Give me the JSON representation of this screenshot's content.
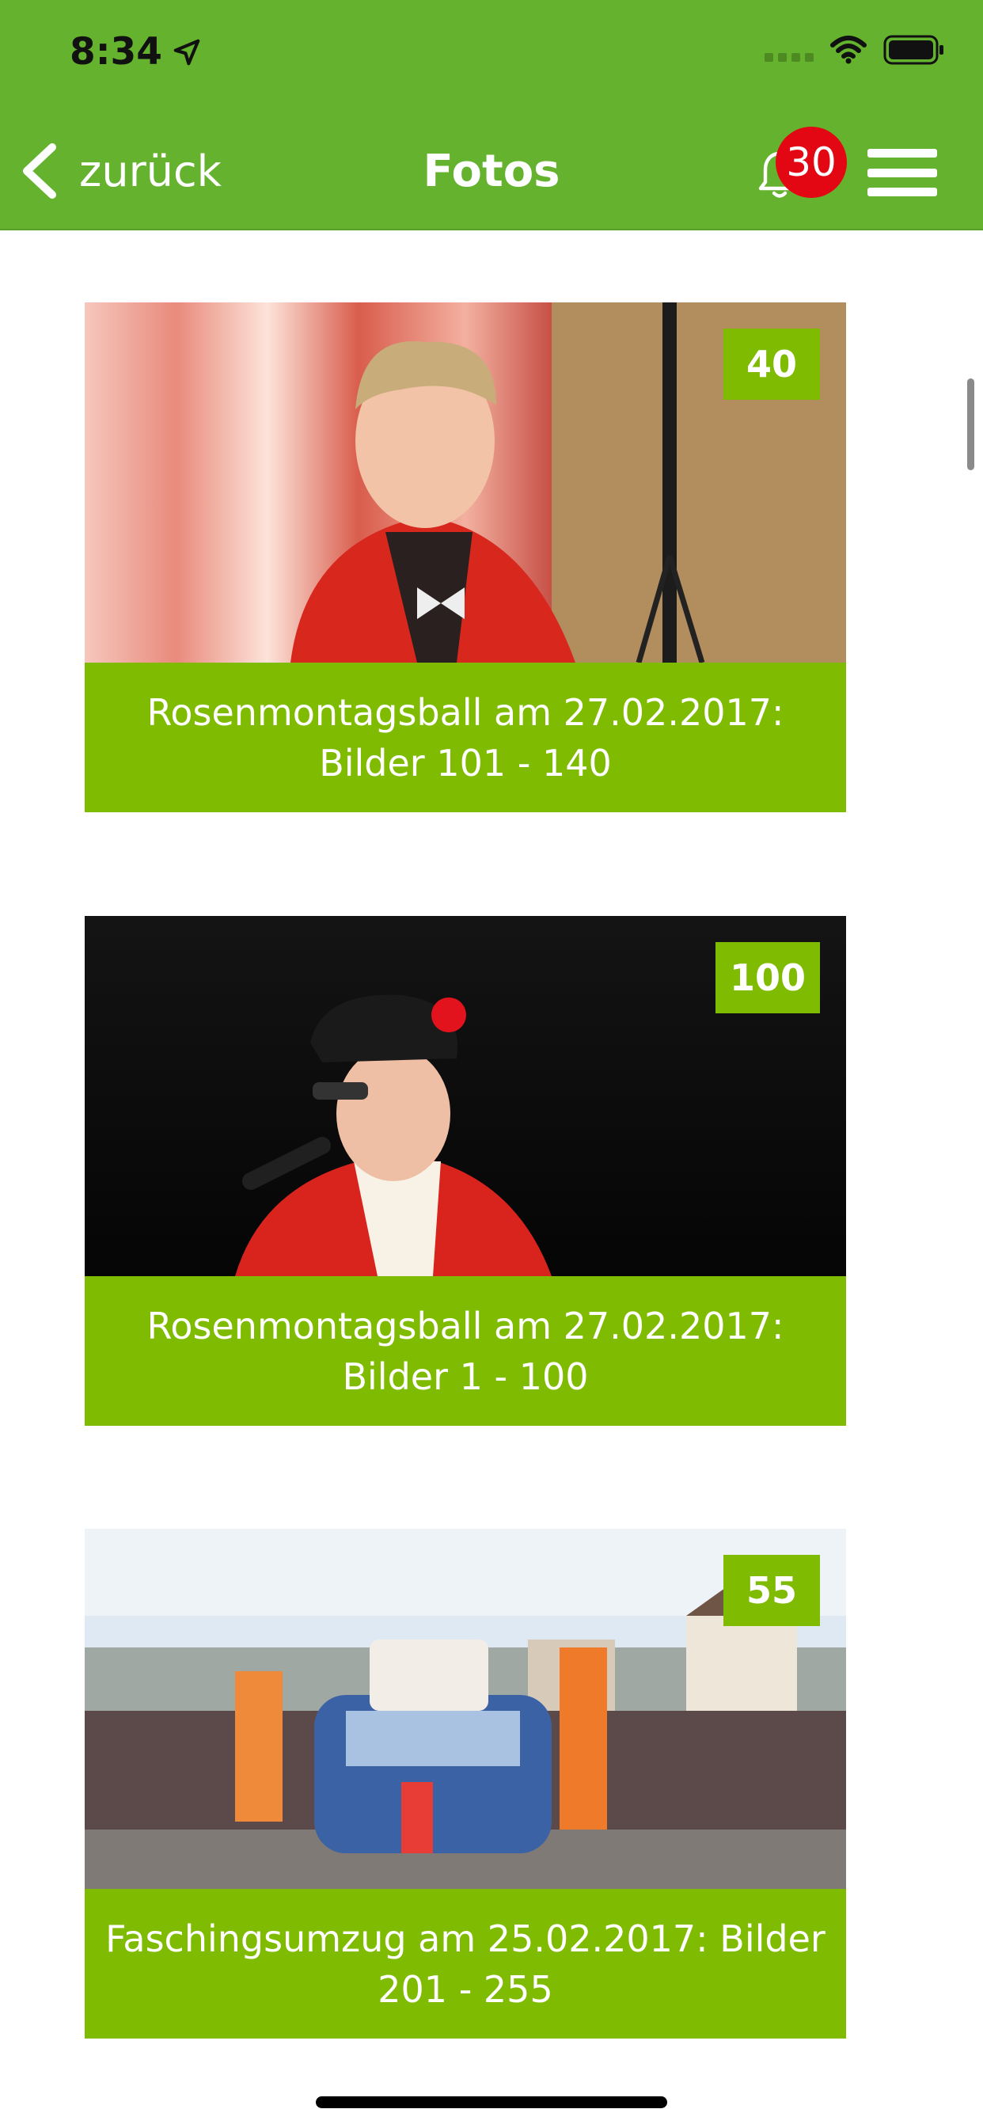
{
  "status_bar": {
    "time": "8:34"
  },
  "nav": {
    "back_label": "zurück",
    "title": "Fotos",
    "notification_count": "30"
  },
  "albums": [
    {
      "count": "40",
      "caption": "Rosenmontagsball am 27.02.2017: Bilder 101 - 140"
    },
    {
      "count": "100",
      "caption": "Rosenmontagsball am 27.02.2017: Bilder 1 - 100"
    },
    {
      "count": "55",
      "caption": "Faschingsumzug am 25.02.2017: Bilder 201 - 255"
    }
  ],
  "colors": {
    "header": "#65b22e",
    "card_green": "#7fbb00",
    "badge_red": "#e30613"
  },
  "icons": {
    "back": "chevron-left-icon",
    "notifications": "bell-icon",
    "menu": "hamburger-menu-icon",
    "location": "location-arrow-icon"
  }
}
